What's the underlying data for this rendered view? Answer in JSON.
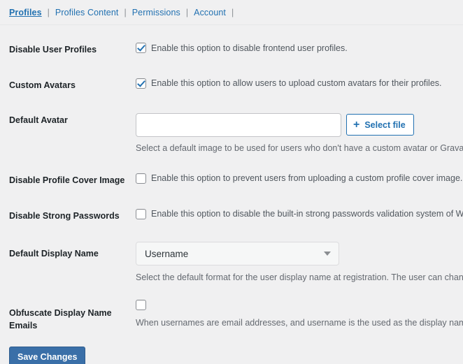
{
  "tabs": {
    "separator": "|",
    "items": [
      {
        "label": "Profiles",
        "active": true
      },
      {
        "label": "Profiles Content",
        "active": false
      },
      {
        "label": "Permissions",
        "active": false
      },
      {
        "label": "Account",
        "active": false
      }
    ]
  },
  "settings": {
    "disable_user_profiles": {
      "label": "Disable User Profiles",
      "checkbox_label": "Enable this option to disable frontend user profiles.",
      "checked": true
    },
    "custom_avatars": {
      "label": "Custom Avatars",
      "checkbox_label": "Enable this option to allow users to upload custom avatars for their profiles.",
      "checked": true
    },
    "default_avatar": {
      "label": "Default Avatar",
      "input_value": "",
      "input_placeholder": "",
      "select_file_label": "Select file",
      "plus_icon": "plus-icon",
      "description": "Select a default image to be used for users who don't have a custom avatar or Gravatar"
    },
    "disable_profile_cover_image": {
      "label": "Disable Profile Cover Image",
      "checkbox_label": "Enable this option to prevent users from uploading a custom profile cover image.",
      "checked": false
    },
    "disable_strong_passwords": {
      "label": "Disable Strong Passwords",
      "checkbox_label": "Enable this option to disable the built-in strong passwords validation system of WP U",
      "checked": false
    },
    "default_display_name": {
      "label": "Default Display Name",
      "selected": "Username",
      "caret_icon": "chevron-down-icon",
      "description": "Select the default format for the user display name at registration. The user can change account."
    },
    "obfuscate_display_name_emails": {
      "label": "Obfuscate Display Name Emails",
      "checked": false,
      "description": "When usernames are email addresses, and username is the used as the display name, p privacy."
    }
  },
  "footer": {
    "save_label": "Save Changes"
  },
  "colors": {
    "accent": "#2271b1",
    "primary_button": "#3a6fa8",
    "page_background": "#f0f0f1",
    "label_text": "#1d2327",
    "description_text": "#646970"
  }
}
